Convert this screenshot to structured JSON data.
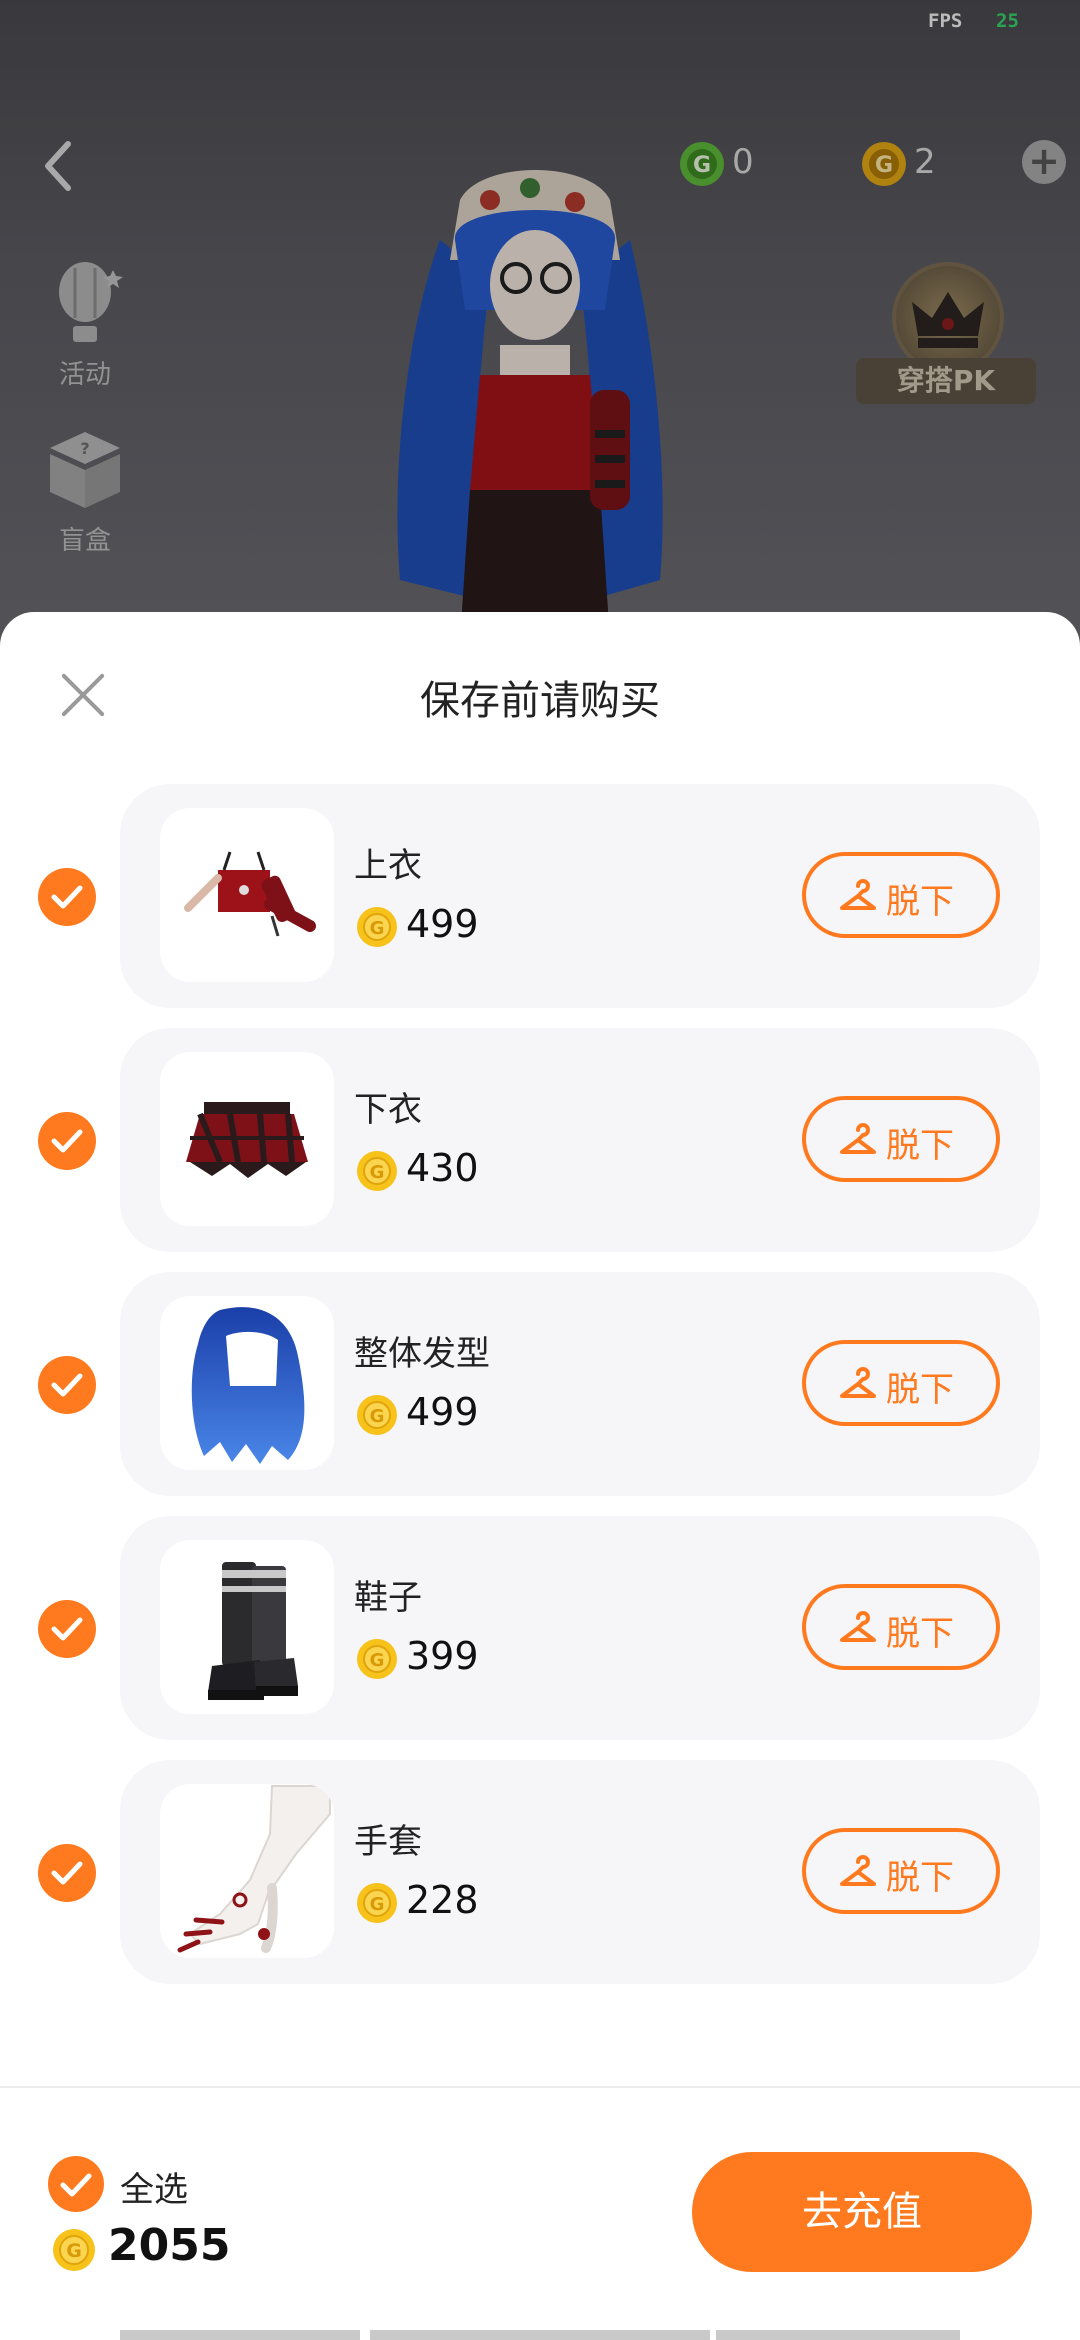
{
  "status": {
    "fps_label": "FPS",
    "fps_value": "25"
  },
  "header": {
    "currency_green": "0",
    "currency_gold": "2"
  },
  "sidebar": {
    "items": [
      {
        "label": "活动",
        "icon": "balloon-icon"
      },
      {
        "label": "盲盒",
        "icon": "blind-box-icon"
      }
    ]
  },
  "pk_badge": {
    "label": "穿搭PK"
  },
  "sheet": {
    "title": "保存前请购买",
    "items": [
      {
        "name": "上衣",
        "price": "499",
        "action": "脱下",
        "checked": true
      },
      {
        "name": "下衣",
        "price": "430",
        "action": "脱下",
        "checked": true
      },
      {
        "name": "整体发型",
        "price": "499",
        "action": "脱下",
        "checked": true
      },
      {
        "name": "鞋子",
        "price": "399",
        "action": "脱下",
        "checked": true
      },
      {
        "name": "手套",
        "price": "228",
        "action": "脱下",
        "checked": true
      }
    ]
  },
  "footer": {
    "select_all_label": "全选",
    "total": "2055",
    "recharge_label": "去充值"
  },
  "colors": {
    "accent": "#ff7a1e",
    "coin_gold": "#f7c21a",
    "coin_green": "#5fb83a"
  }
}
